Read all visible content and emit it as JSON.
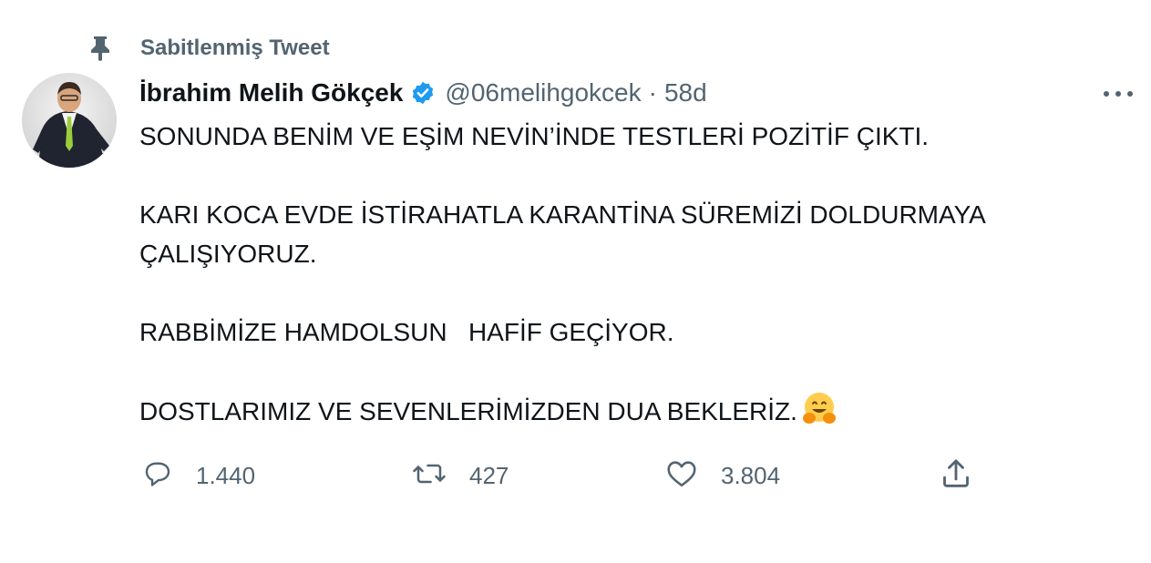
{
  "pinned": {
    "label": "Sabitlenmiş Tweet",
    "icon": "pin-icon"
  },
  "author": {
    "display_name": "İbrahim Melih Gökçek",
    "verified": true,
    "verified_icon": "verified-badge-icon",
    "handle": "@06melihgokcek",
    "separator": "·",
    "time": "58d"
  },
  "tweet": {
    "paragraphs": [
      "SONUNDA BENİM VE EŞİM NEVİN’İNDE TESTLERİ POZİTİF ÇIKTI.",
      "KARI KOCA EVDE İSTİRAHATLA KARANTİNA SÜREMİZİ DOLDURMAYA ÇALIŞIYORUZ.",
      "RABBİMİZE HAMDOLSUN   HAFİF GEÇİYOR.",
      "DOSTLARIMIZ VE SEVENLERİMİZDEN DUA BEKLERİZ."
    ],
    "emoji": "hugging-face-emoji"
  },
  "actions": {
    "reply_count": "1.440",
    "retweet_count": "427",
    "like_count": "3.804"
  },
  "colors": {
    "text_primary": "#0f1419",
    "text_secondary": "#536471",
    "verified_blue": "#1d9bf0",
    "background": "#ffffff"
  }
}
